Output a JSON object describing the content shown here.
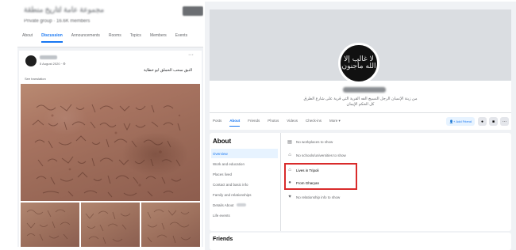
{
  "group": {
    "title": "مجموعة عامة لتاريخ منطقة",
    "subtitle": "Private group · 16.6K members",
    "tabs": [
      "About",
      "Discussion",
      "Announcements",
      "Rooms",
      "Topics",
      "Members",
      "Events"
    ],
    "active_tab": "Discussion"
  },
  "post": {
    "date": "5 August 2020 · ⚙",
    "text": "النبق سحب الحملق ابو خطاية",
    "see_translation": "See translation",
    "more": "···"
  },
  "profile": {
    "pic_text": "لا غالب إلا الله مأجنون",
    "bio_line1": "من زينة الإنسان الرجل النسيج الفه القرية التي قرية على شارع الطرق",
    "bio_line2": "كل الحكم الإيمان"
  },
  "nav": {
    "tabs": [
      "Posts",
      "About",
      "Friends",
      "Photos",
      "Videos",
      "Check-ins",
      "More ▾"
    ],
    "active_tab": "About",
    "add_friend": "Add Friend",
    "messenger_icon": "messenger-icon",
    "follow_icon": "follow-icon",
    "more": "···"
  },
  "about": {
    "title": "About",
    "menu": [
      "Overview",
      "Work and education",
      "Places lived",
      "Contact and basic info",
      "Family and relationships",
      "Details About",
      "Life events"
    ],
    "active": "Overview",
    "rows": [
      {
        "icon": "briefcase-icon",
        "text": "No workplaces to show",
        "strong": false
      },
      {
        "icon": "graduation-cap-icon",
        "text": "No schools/universities to show",
        "strong": false
      },
      {
        "icon": "home-icon",
        "text": "Lives in Tripoli",
        "strong": true
      },
      {
        "icon": "location-pin-icon",
        "text": "From Gharyan",
        "strong": true
      },
      {
        "icon": "heart-icon",
        "text": "No relationship info to show",
        "strong": false
      }
    ]
  },
  "friends": {
    "title": "Friends"
  },
  "colors": {
    "accent": "#1877f2",
    "highlight": "#d92b2b",
    "background": "#f0f2f5"
  }
}
